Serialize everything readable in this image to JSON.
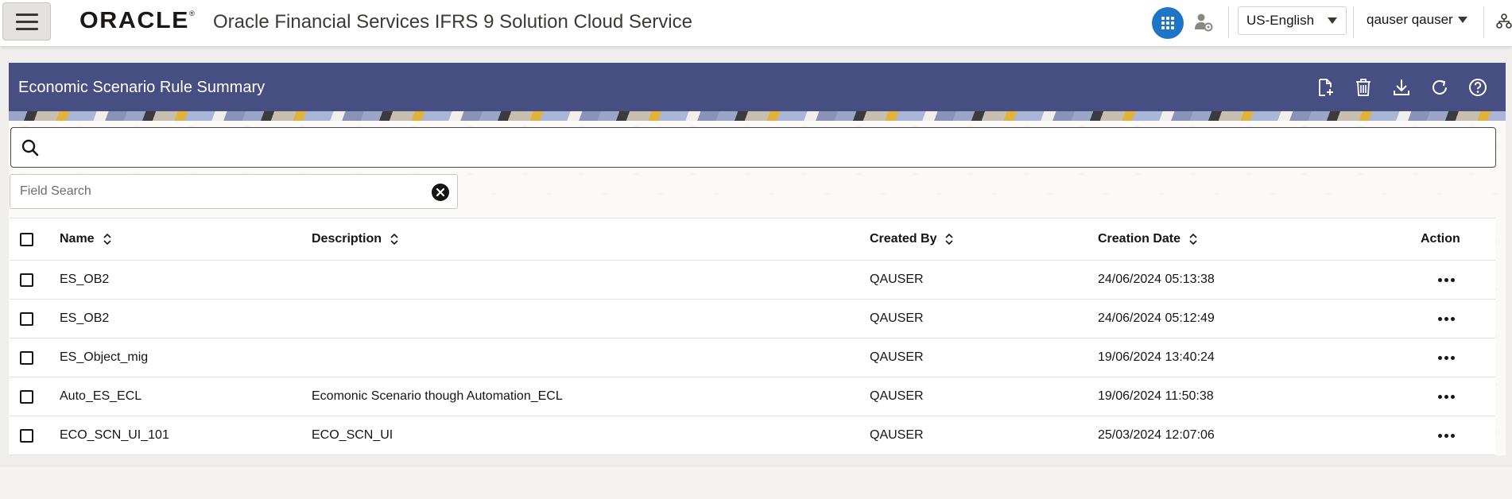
{
  "header": {
    "logo_text": "ORACLE",
    "app_title": "Oracle Financial Services IFRS 9 Solution Cloud Service",
    "language": "US-English",
    "user_name": "qauser qauser"
  },
  "panel": {
    "title": "Economic Scenario Rule Summary",
    "toolbar": [
      "add-icon",
      "delete-icon",
      "download-icon",
      "refresh-icon",
      "help-icon"
    ]
  },
  "search": {
    "value": "",
    "field_search_placeholder": "Field Search"
  },
  "table": {
    "columns": {
      "name": "Name",
      "description": "Description",
      "created_by": "Created By",
      "creation_date": "Creation Date",
      "action": "Action"
    },
    "rows": [
      {
        "name": "ES_OB2",
        "description": "",
        "created_by": "QAUSER",
        "creation_date": "24/06/2024 05:13:38"
      },
      {
        "name": "ES_OB2",
        "description": "",
        "created_by": "QAUSER",
        "creation_date": "24/06/2024 05:12:49"
      },
      {
        "name": "ES_Object_mig",
        "description": "",
        "created_by": "QAUSER",
        "creation_date": "19/06/2024 13:40:24"
      },
      {
        "name": "Auto_ES_ECL",
        "description": "Ecomonic Scenario though Automation_ECL",
        "created_by": "QAUSER",
        "creation_date": "19/06/2024 11:50:38"
      },
      {
        "name": "ECO_SCN_UI_101",
        "description": "ECO_SCN_UI",
        "created_by": "QAUSER",
        "creation_date": "25/03/2024 12:07:06"
      }
    ]
  },
  "colors": {
    "panel_header": "#474e82",
    "apps_button": "#1e74c6"
  }
}
